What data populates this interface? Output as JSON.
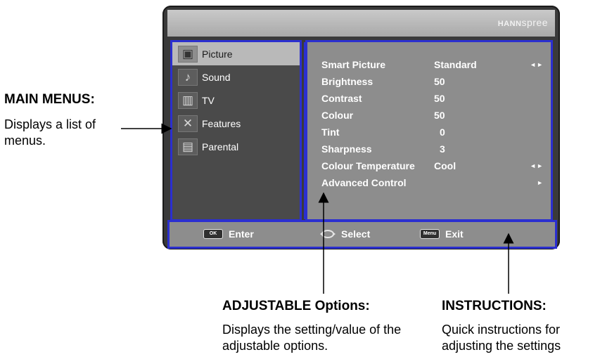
{
  "tv": {
    "brand": {
      "prefix": "HANN",
      "suffix": "spree"
    },
    "menu_items": [
      {
        "label": "Picture",
        "icon": "picture-icon",
        "active": true
      },
      {
        "label": "Sound",
        "icon": "sound-icon",
        "active": false
      },
      {
        "label": "TV",
        "icon": "tv-icon",
        "active": false
      },
      {
        "label": "Features",
        "icon": "features-icon",
        "active": false
      },
      {
        "label": "Parental",
        "icon": "parental-icon",
        "active": false
      }
    ],
    "options": [
      {
        "label": "Smart Picture",
        "value": "Standard",
        "arrows": "◄►"
      },
      {
        "label": "Brightness",
        "value": "50",
        "arrows": ""
      },
      {
        "label": "Contrast",
        "value": "50",
        "arrows": ""
      },
      {
        "label": "Colour",
        "value": "50",
        "arrows": ""
      },
      {
        "label": "Tint",
        "value": "0",
        "arrows": ""
      },
      {
        "label": "Sharpness",
        "value": "3",
        "arrows": ""
      },
      {
        "label": "Colour Temperature",
        "value": "Cool",
        "arrows": "◄►"
      },
      {
        "label": "Advanced Control",
        "value": "",
        "arrows": "►"
      }
    ],
    "footer": {
      "enter": {
        "key": "OK",
        "label": "Enter"
      },
      "select": {
        "label": "Select"
      },
      "exit": {
        "key": "Menu",
        "label": "Exit"
      }
    }
  },
  "callouts": {
    "main_menus": {
      "title": "MAIN MENUS:",
      "desc": "Displays a list of menus."
    },
    "adjustable": {
      "title": "ADJUSTABLE Options:",
      "desc": "Displays the setting/value of the adjustable options."
    },
    "instructions": {
      "title": "INSTRUCTIONS:",
      "desc": "Quick instructions for adjusting the settings"
    }
  },
  "colors": {
    "frame_border": "#2b2fd0",
    "frame_dark": "#3a3a3a",
    "panel_gray": "#8d8d8d"
  }
}
